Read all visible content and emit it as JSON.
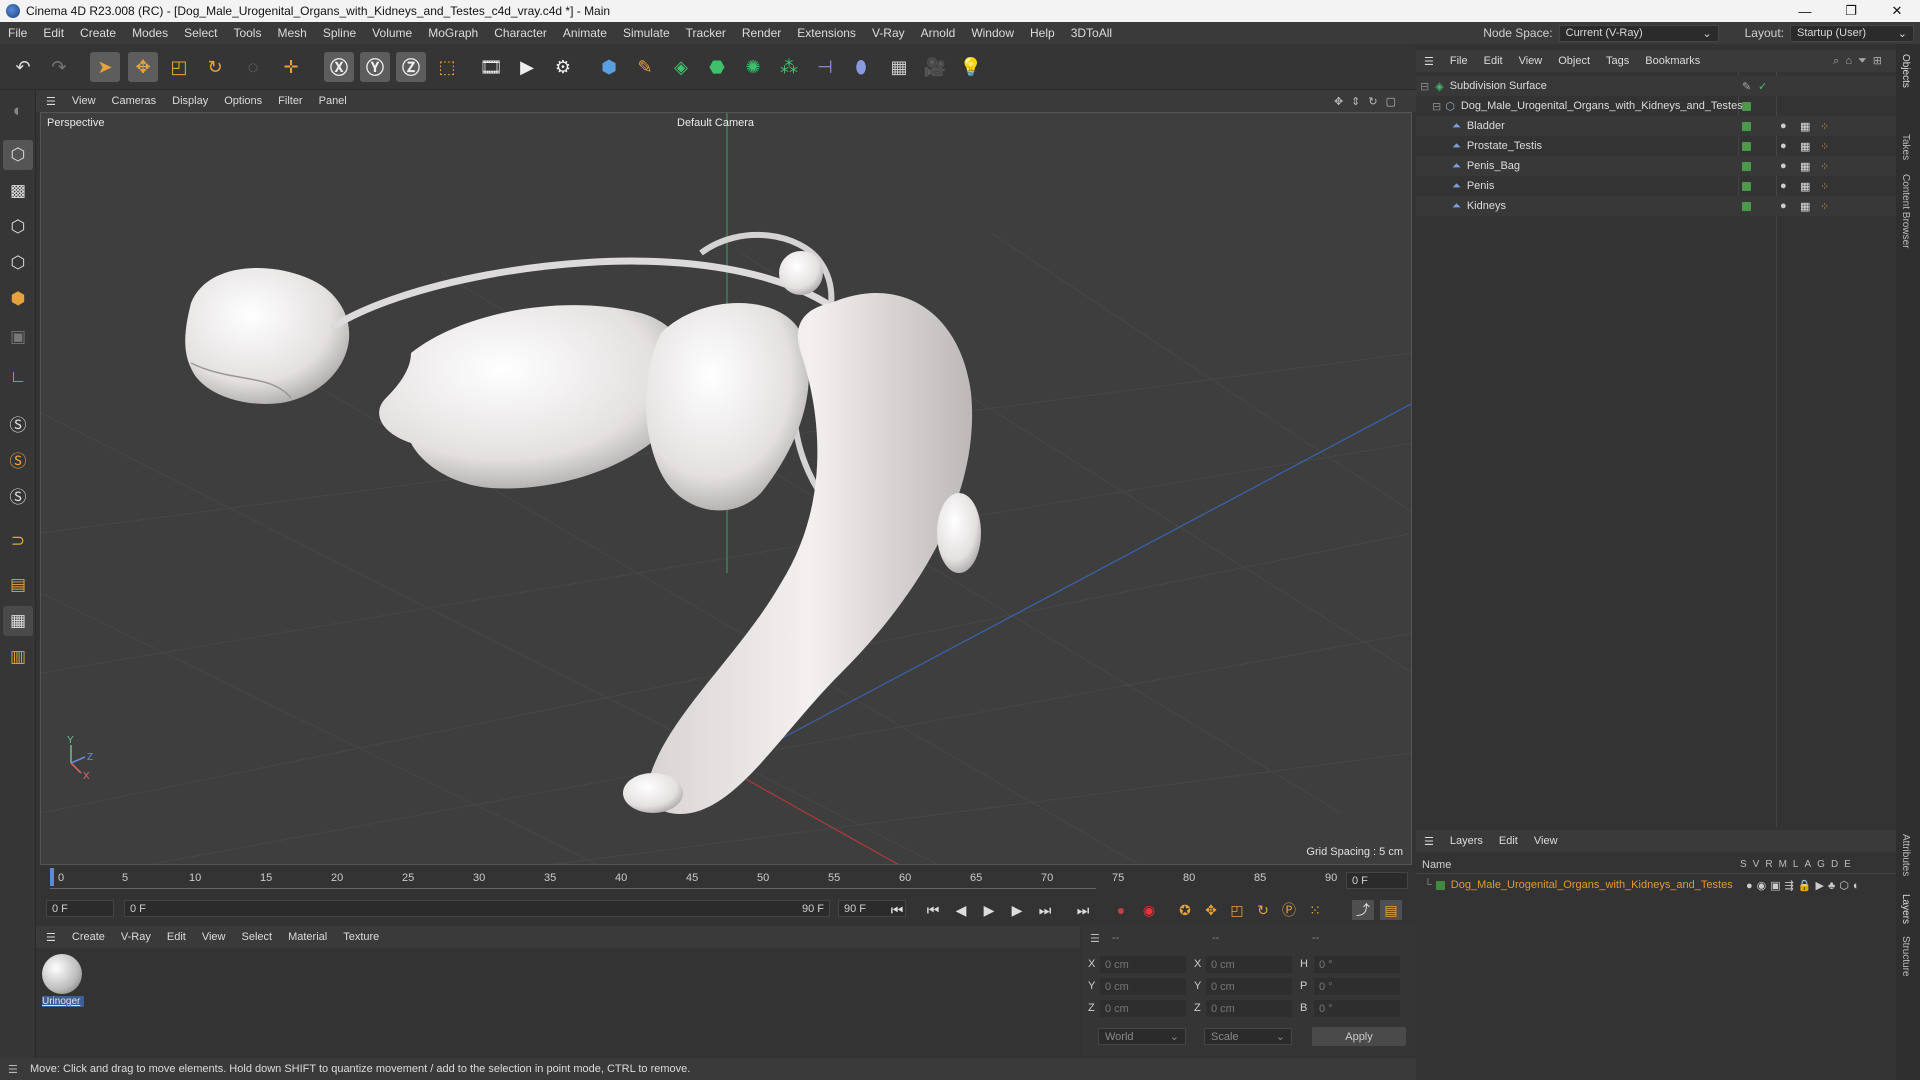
{
  "window": {
    "title": "Cinema 4D R23.008 (RC) - [Dog_Male_Urogenital_Organs_with_Kidneys_and_Testes_c4d_vray.c4d *] - Main",
    "controls": [
      "—",
      "❐",
      "✕"
    ]
  },
  "menubar": {
    "items": [
      "File",
      "Edit",
      "Create",
      "Modes",
      "Select",
      "Tools",
      "Mesh",
      "Spline",
      "Volume",
      "MoGraph",
      "Character",
      "Animate",
      "Simulate",
      "Tracker",
      "Render",
      "Extensions",
      "V-Ray",
      "Arnold",
      "Window",
      "Help",
      "3DToAll"
    ],
    "node_space_label": "Node Space:",
    "node_space_value": "Current (V-Ray)",
    "layout_label": "Layout:",
    "layout_value": "Startup (User)"
  },
  "viewport": {
    "menu": [
      "View",
      "Cameras",
      "Display",
      "Options",
      "Filter",
      "Panel"
    ],
    "view_name": "Perspective",
    "camera": "Default Camera",
    "grid_spacing": "Grid Spacing : 5 cm",
    "axis_labels": {
      "y": "Y",
      "z": "Z",
      "x": "X"
    }
  },
  "timeline": {
    "ticks": [
      "0",
      "5",
      "10",
      "15",
      "20",
      "25",
      "30",
      "35",
      "40",
      "45",
      "50",
      "55",
      "60",
      "65",
      "70",
      "75",
      "80",
      "85",
      "90"
    ],
    "current_frame": "0 F",
    "start_frame": "0 F",
    "range_start": "0 F",
    "range_end": "90 F",
    "end_frame": "90 F"
  },
  "materials": {
    "menu": [
      "Create",
      "V-Ray",
      "Edit",
      "View",
      "Select",
      "Material",
      "Texture"
    ],
    "items": [
      {
        "name": "Urinoger"
      }
    ]
  },
  "coordinates": {
    "header": [
      "--",
      "--",
      "--"
    ],
    "rows": [
      {
        "a": "X",
        "av": "0 cm",
        "b": "X",
        "bv": "0 cm",
        "c": "H",
        "cv": "0 °"
      },
      {
        "a": "Y",
        "av": "0 cm",
        "b": "Y",
        "bv": "0 cm",
        "c": "P",
        "cv": "0 °"
      },
      {
        "a": "Z",
        "av": "0 cm",
        "b": "Z",
        "bv": "0 cm",
        "c": "B",
        "cv": "0 °"
      }
    ],
    "world": "World",
    "scale": "Scale",
    "apply": "Apply"
  },
  "status": "Move: Click and drag to move elements. Hold down SHIFT to quantize movement / add to the selection in point mode, CTRL to remove.",
  "object_manager": {
    "menu": [
      "File",
      "Edit",
      "View",
      "Object",
      "Tags",
      "Bookmarks"
    ],
    "objects": [
      {
        "name": "Subdivision Surface",
        "depth": 0
      },
      {
        "name": "Dog_Male_Urogenital_Organs_with_Kidneys_and_Testes",
        "depth": 1
      },
      {
        "name": "Bladder",
        "depth": 2
      },
      {
        "name": "Prostate_Testis",
        "depth": 2
      },
      {
        "name": "Penis_Bag",
        "depth": 2
      },
      {
        "name": "Penis",
        "depth": 2
      },
      {
        "name": "Kidneys",
        "depth": 2
      }
    ]
  },
  "layers": {
    "menu": [
      "Layers",
      "Edit",
      "View"
    ],
    "name_header": "Name",
    "col_headers": [
      "S",
      "V",
      "R",
      "M",
      "L",
      "A",
      "G",
      "D",
      "E"
    ],
    "items": [
      {
        "name": "Dog_Male_Urogenital_Organs_with_Kidneys_and_Testes",
        "color": "#3f8a3f"
      }
    ]
  },
  "side_tabs": [
    "Objects",
    "Takes",
    "Content Browser",
    "Attributes",
    "Layers",
    "Structure"
  ],
  "colors": {
    "accent_orange": "#e6a33c",
    "layer_text": "#e39a2d",
    "green_tag": "#4a9a4a"
  }
}
